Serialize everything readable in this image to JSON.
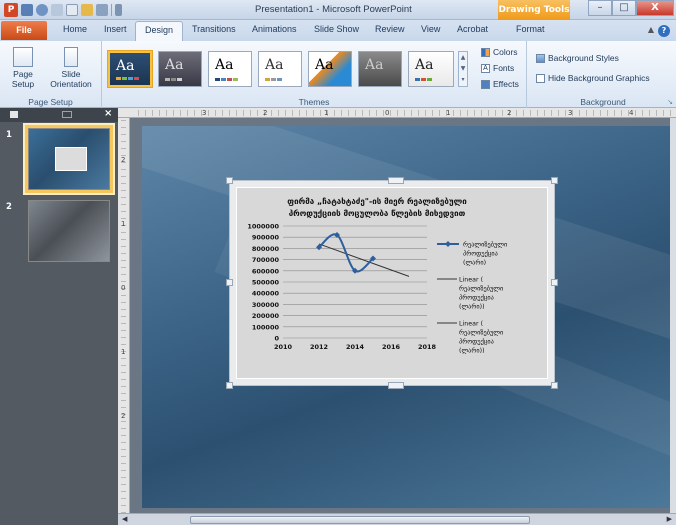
{
  "titlebar": {
    "window_title": "Presentation1 - Microsoft PowerPoint",
    "contextual_tab_group": "Drawing Tools",
    "app_icon": "P"
  },
  "tabs": [
    {
      "label": "File"
    },
    {
      "label": "Home"
    },
    {
      "label": "Insert"
    },
    {
      "label": "Design"
    },
    {
      "label": "Transitions"
    },
    {
      "label": "Animations"
    },
    {
      "label": "Slide Show"
    },
    {
      "label": "Review"
    },
    {
      "label": "View"
    },
    {
      "label": "Acrobat"
    },
    {
      "label": "Format"
    }
  ],
  "ribbon": {
    "page_setup": {
      "page_setup_label": "Page Setup",
      "slide_orientation_label": "Slide Orientation",
      "group_label": "Page Setup"
    },
    "themes": {
      "group_label": "Themes",
      "thumb_text": "Aa"
    },
    "theme_options": {
      "colors": "Colors",
      "fonts": "Fonts",
      "effects": "Effects"
    },
    "background": {
      "styles": "Background Styles",
      "hide_graphics": "Hide Background Graphics",
      "group_label": "Background"
    }
  },
  "slides_pane": {
    "slides": [
      {
        "number": "1"
      },
      {
        "number": "2"
      }
    ]
  },
  "ruler": {
    "h_ticks": [
      "3",
      "2",
      "1",
      "0",
      "1",
      "2",
      "3",
      "4"
    ],
    "v_ticks": [
      "2",
      "1",
      "0",
      "1",
      "2"
    ]
  },
  "chart_data": {
    "type": "scatter",
    "title_line1": "ფირმა „ჩატახტაძე\"-ის მიერ რეალიზებული",
    "title_line2": "პროდუქციის მოცულობა წლების მიხედვით",
    "xlabel": "",
    "ylabel": "",
    "xlim": [
      2010,
      2018
    ],
    "ylim": [
      0,
      1000000
    ],
    "x_ticks": [
      "2010",
      "2012",
      "2014",
      "2016",
      "2018"
    ],
    "y_ticks": [
      "0",
      "100000",
      "200000",
      "300000",
      "400000",
      "500000",
      "600000",
      "700000",
      "800000",
      "900000",
      "1000000"
    ],
    "series": [
      {
        "name": "რეალიზებული პროდუქცია (ლარი)",
        "x": [
          2012,
          2013,
          2014,
          2015
        ],
        "y": [
          810000,
          920000,
          600000,
          710000
        ],
        "color": "#2e5f9c"
      }
    ],
    "trendlines": [
      {
        "name": "Linear ( რეალიზებული პროდუქცია (ლარი))",
        "x": [
          2012,
          2017
        ],
        "y": [
          840000,
          550000
        ],
        "color": "#333333"
      }
    ],
    "legend": [
      {
        "text": "რეალიზებული პროდუქცია (ლარი)",
        "style": "series-marker"
      },
      {
        "text": "Linear ( რეალიზებული პროდუქცია (ლარი))",
        "style": "line"
      },
      {
        "text": "Linear ( რეალიზებული პროდუქცია (ლარი))",
        "style": "line"
      }
    ],
    "legend_position": "right",
    "grid": true
  },
  "colors": {
    "file_tab": "#c84a17",
    "drawing_tools": "#f09a1a",
    "selected_theme_border": "#f5c243",
    "series_color": "#2e5f9c"
  }
}
